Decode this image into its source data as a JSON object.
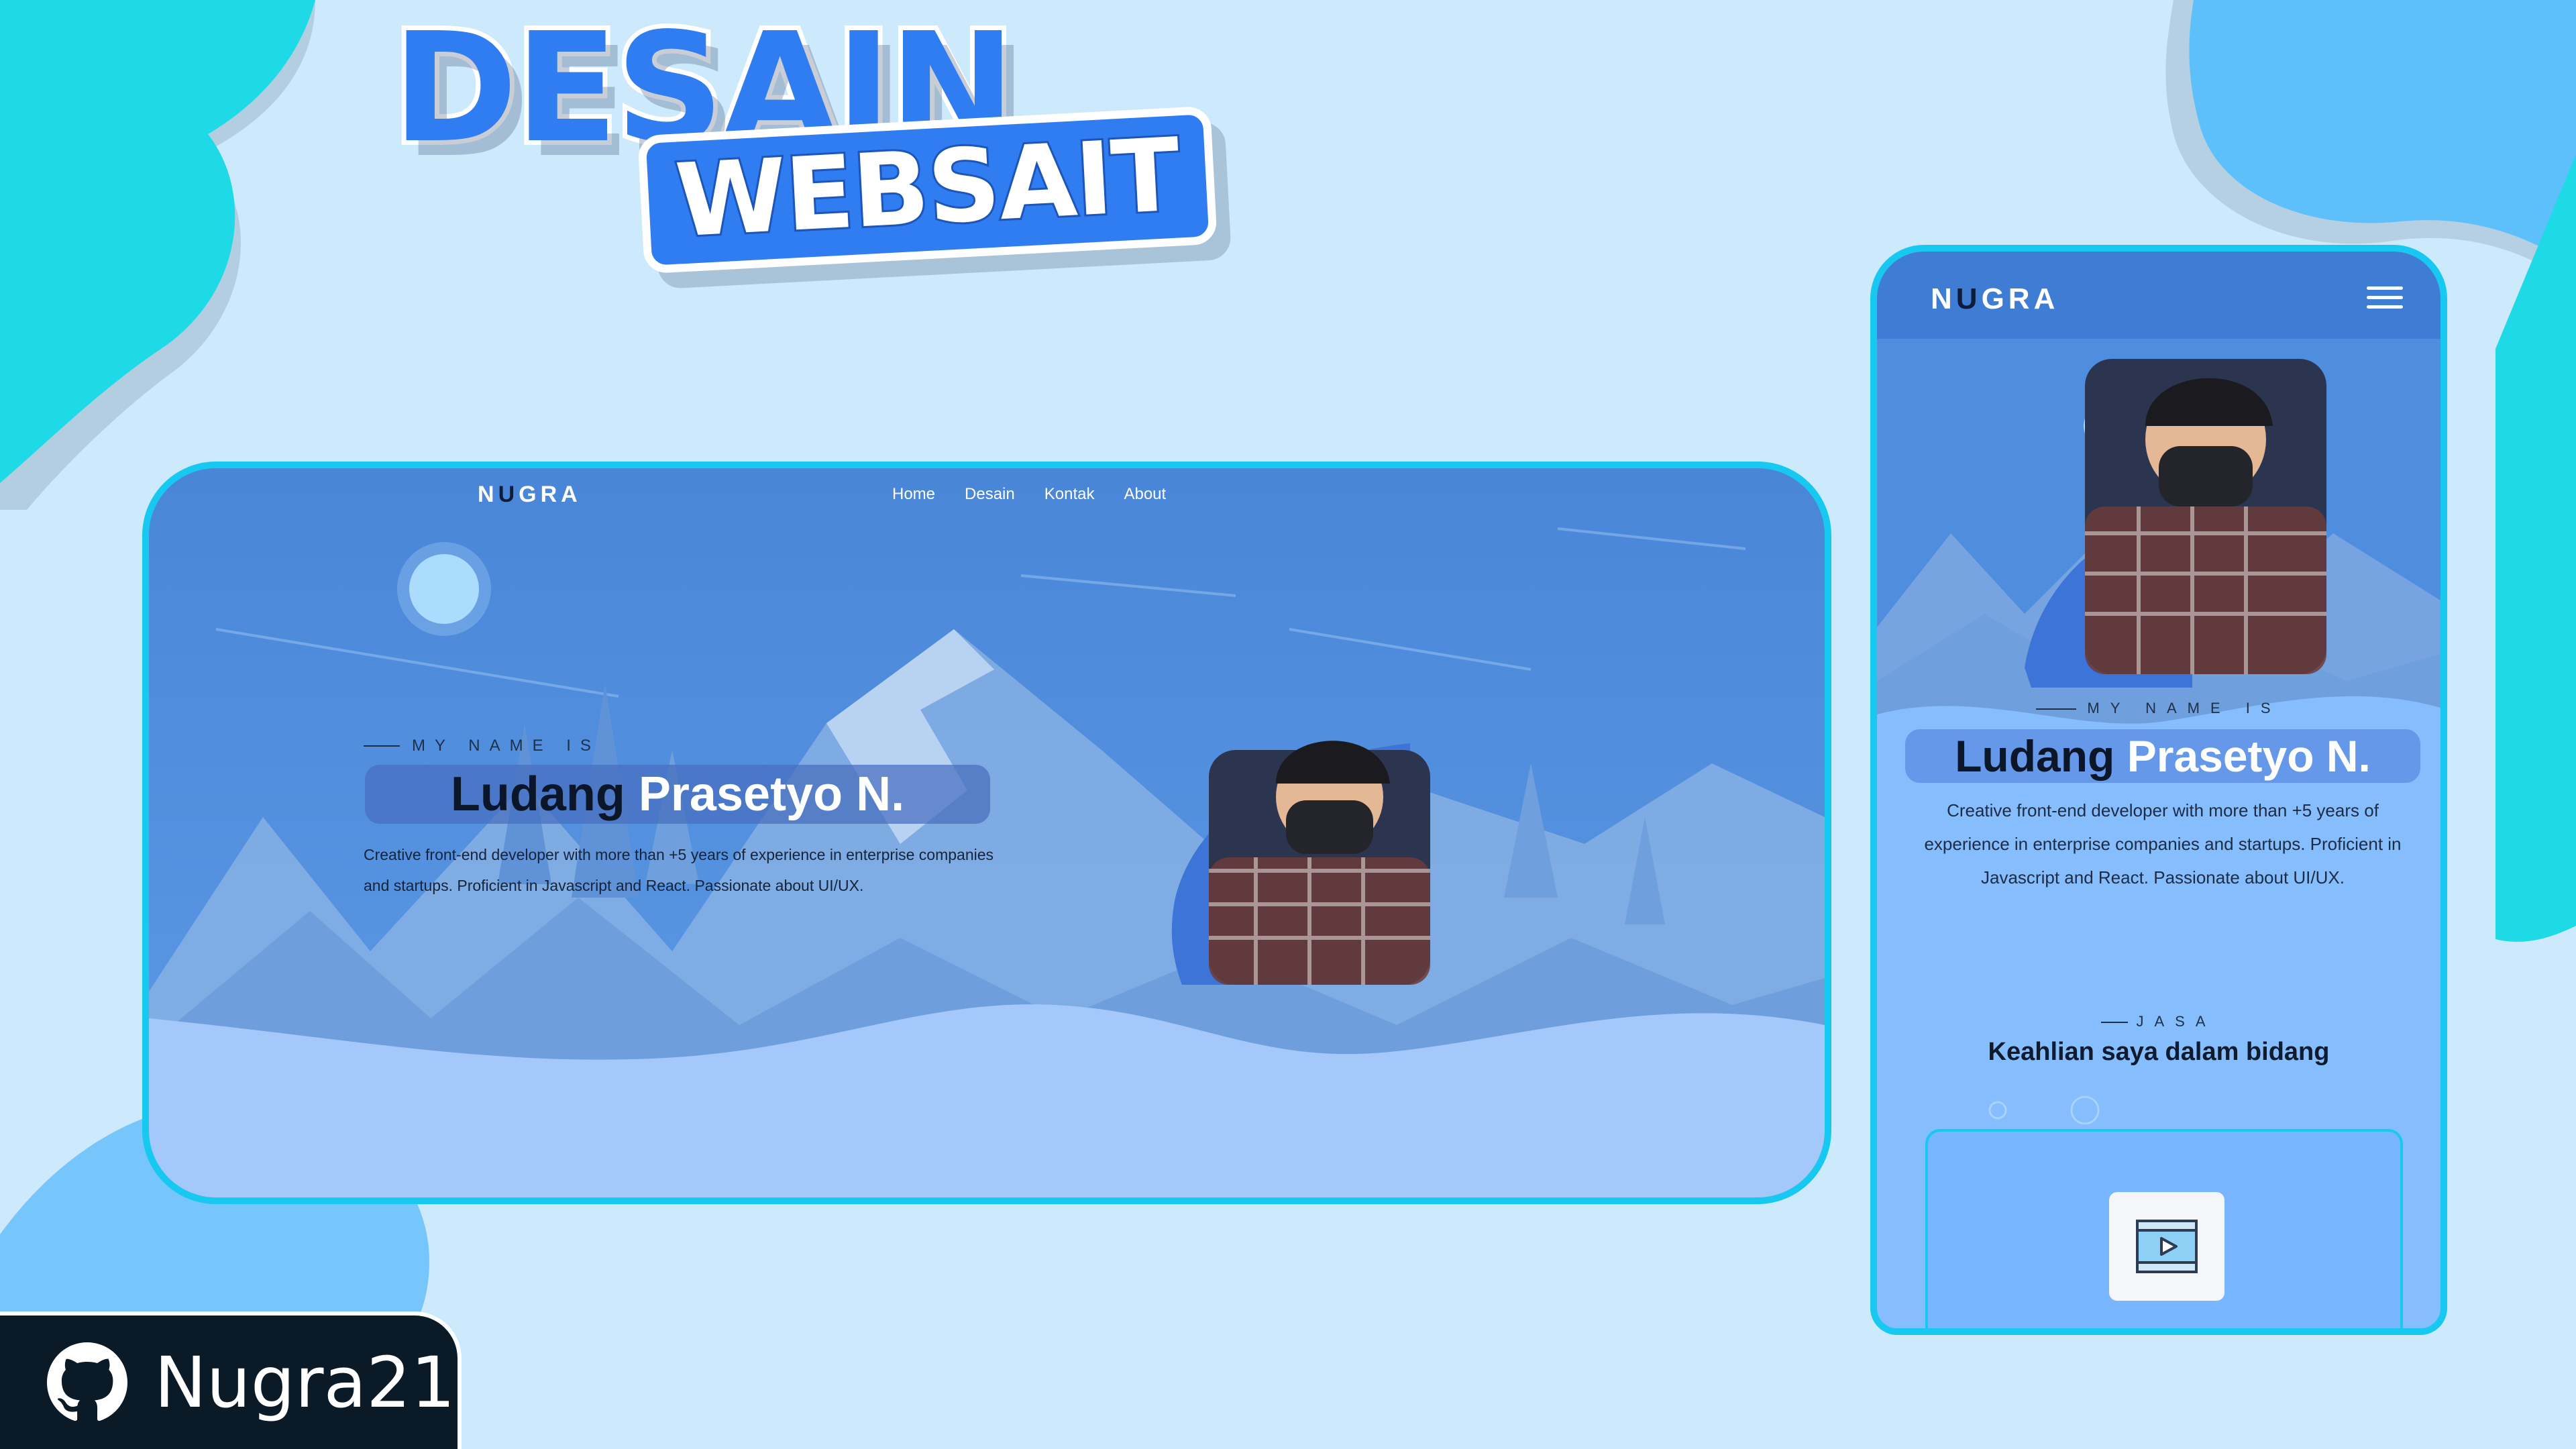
{
  "banner": {
    "title_line1": "DESAIN",
    "title_line2": "WEBSAIT"
  },
  "desktop": {
    "nav": {
      "logo_first": "N",
      "logo_u": "U",
      "logo_rest": "GRA",
      "links": [
        "Home",
        "Desain",
        "Kontak",
        "About"
      ]
    },
    "hero": {
      "eyebrow": "MY NAME IS",
      "name_first": "Ludang",
      "name_rest": "Prasetyo N.",
      "description": "Creative front-end developer with more than +5 years of experience in enterprise companies and startups. Proficient in Javascript and React. Passionate about UI/UX."
    }
  },
  "mobile": {
    "nav": {
      "logo_first": "N",
      "logo_u": "U",
      "logo_rest": "GRA",
      "menu_icon": "hamburger-icon"
    },
    "hero": {
      "eyebrow": "MY NAME IS",
      "name_first": "Ludang",
      "name_rest": "Prasetyo N.",
      "description": "Creative front-end developer with more than +5 years of experience in enterprise companies and startups. Proficient in Javascript and React. Passionate about UI/UX."
    },
    "services": {
      "eyebrow": "JASA",
      "heading": "Keahlian saya dalam bidang",
      "card_icon": "video-icon"
    }
  },
  "github": {
    "icon": "github-icon",
    "username": "Nugra21"
  },
  "colors": {
    "background": "#cde9fc",
    "accent_cyan": "#17c8f0",
    "brand_blue": "#2f7df0",
    "badge_dark": "#0b1a27"
  }
}
